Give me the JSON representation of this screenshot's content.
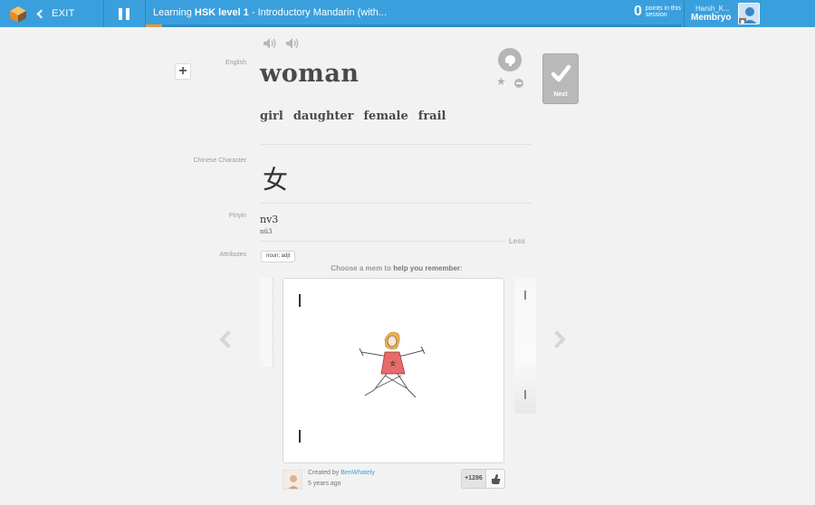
{
  "header": {
    "exit_label": "EXIT",
    "title_prefix": "Learning ",
    "title_bold": "HSK level 1",
    "title_rest": " - Introductory Mandarin (with...",
    "progress": 0.03,
    "points_value": "0",
    "points_label": "points in this session",
    "user_name": "Harsh_K...",
    "user_level": "Membryo"
  },
  "card": {
    "labels": {
      "english": "English",
      "chinese_character": "Chinese Character",
      "pinyin": "Pinyin",
      "attributes": "Attributes"
    },
    "word": "woman",
    "alternatives": [
      "girl",
      "daughter",
      "female",
      "frail"
    ],
    "character": "女",
    "pinyin": "nv3",
    "pinyin_sub": "nü3",
    "less_label": "Less",
    "attribute": "noun; adjt",
    "next_label": "Next"
  },
  "mems": {
    "choose_prefix": "Choose a mem to ",
    "choose_emphasis": "help you remember",
    "choose_suffix": ":",
    "created_by_label": "Created by ",
    "creator": "BenWhately",
    "age": "5 years ago",
    "votes": "+1286"
  },
  "colors": {
    "topbar": "#3aa0dd",
    "progress": "#e69a3a",
    "link": "#3aa0dd",
    "next_button": "#b9b9b9"
  }
}
